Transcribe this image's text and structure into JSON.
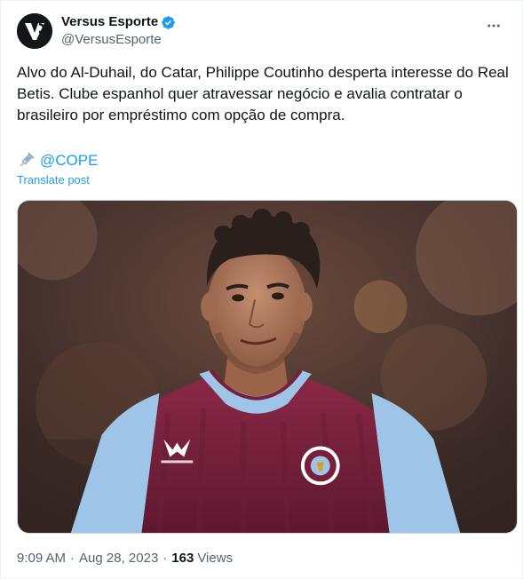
{
  "author": {
    "display_name": "Versus Esporte",
    "handle": "@VersusEsporte",
    "verified_icon": "verified-badge-icon",
    "avatar_icon": "versus-logo-icon"
  },
  "post": {
    "text": "Alvo do Al-Duhail, do Catar, Philippe Coutinho desperta interesse do Real Betis. Clube espanhol quer atravessar negócio e avalia contratar o brasileiro por empréstimo com opção de compra.",
    "source_icon": "syringe-icon",
    "source_label": "@COPE",
    "translate_label": "Translate post",
    "media_icon": "football-player-photo"
  },
  "meta": {
    "time": "9:09 AM",
    "separator_1": "·",
    "date": "Aug 28, 2023",
    "separator_2": "·",
    "views_count": "163",
    "views_label": "Views"
  },
  "colors": {
    "accent": "#1d9bf0",
    "text": "#0f1419",
    "secondary": "#536471",
    "jersey_claret": "#7a1f3a",
    "jersey_blue": "#9ec5e8"
  }
}
